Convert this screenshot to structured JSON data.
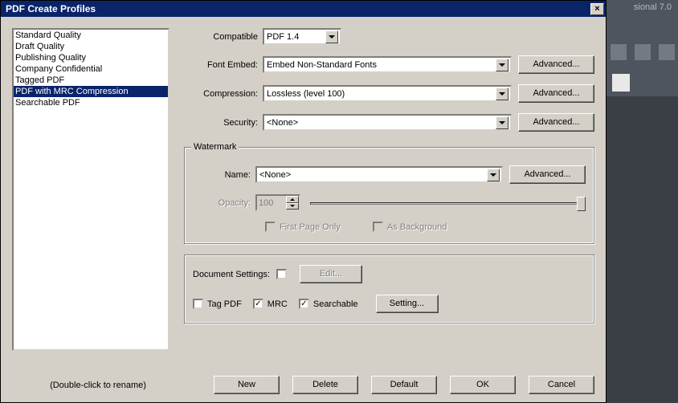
{
  "background": {
    "app_title_suffix": "sional 7.0"
  },
  "dialog": {
    "title": "PDF Create Profiles",
    "close_x": "×"
  },
  "profiles": [
    "Standard Quality",
    "Draft Quality",
    "Publishing Quality",
    "Company Confidential",
    "Tagged PDF",
    "PDF with MRC Compression",
    "Searchable PDF"
  ],
  "selected_profile_index": 5,
  "form": {
    "compatible_label": "Compatible",
    "compatible_value": "PDF 1.4",
    "font_embed_label": "Font Embed:",
    "font_embed_value": "Embed Non-Standard Fonts",
    "compression_label": "Compression:",
    "compression_value": "Lossless (level 100)",
    "security_label": "Security:",
    "security_value": "<None>",
    "advanced_label": "Advanced..."
  },
  "watermark": {
    "group_title": "Watermark",
    "name_label": "Name:",
    "name_value": "<None>",
    "opacity_label": "Opacity:",
    "opacity_value": "100",
    "first_page_only": "First Page Only",
    "as_background": "As Background",
    "advanced_label": "Advanced..."
  },
  "settings": {
    "doc_settings_label": "Document Settings:",
    "edit_label": "Edit...",
    "tag_pdf": "Tag PDF",
    "mrc": "MRC",
    "searchable": "Searchable",
    "setting_btn": "Setting...",
    "tag_pdf_checked": false,
    "mrc_checked": true,
    "searchable_checked": true,
    "doc_settings_checked": false
  },
  "hint": "(Double-click to rename)",
  "buttons": {
    "new": "New",
    "delete": "Delete",
    "default": "Default",
    "ok": "OK",
    "cancel": "Cancel"
  }
}
